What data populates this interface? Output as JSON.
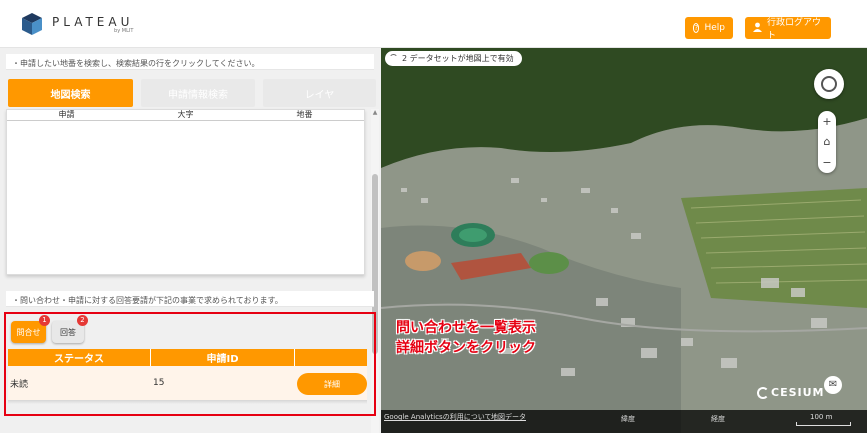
{
  "header": {
    "logo_title": "PLATEAU",
    "logo_sub": "by MLIT",
    "help_label": "Help",
    "logout_label": "行政ログアウト"
  },
  "left": {
    "notice_search": "・申請したい地番を検索し、検索結果の行をクリックしてください。",
    "tabs": [
      "地図検索",
      "申請情報検索",
      "レイヤ"
    ],
    "result_columns": [
      "申請",
      "大字",
      "地番"
    ],
    "notice_inquiry": "・問い合わせ・申請に対する回答要請が下記の事業で求められております。",
    "pills": [
      {
        "label": "問合せ",
        "count": "1"
      },
      {
        "label": "回答",
        "count": "2"
      }
    ],
    "table": {
      "headers": [
        "ステータス",
        "申請ID",
        ""
      ],
      "rows": [
        {
          "status": "未読",
          "id": "15",
          "action": "詳細"
        }
      ]
    }
  },
  "map": {
    "dataset_status": "2 データセットが地図上で有効",
    "annotation_line1": "問い合わせを一覧表示",
    "annotation_line2": "詳細ボタンをクリック",
    "cesium_label": "CESIUM",
    "footer": {
      "analytics_link": "Google Analyticsの利用について",
      "map_data_link": "地図データ",
      "lat_label": "緯度",
      "lon_label": "経度",
      "scale_label": "100 m"
    }
  },
  "colors": {
    "accent": "#ff9800",
    "highlight": "#e60012"
  }
}
